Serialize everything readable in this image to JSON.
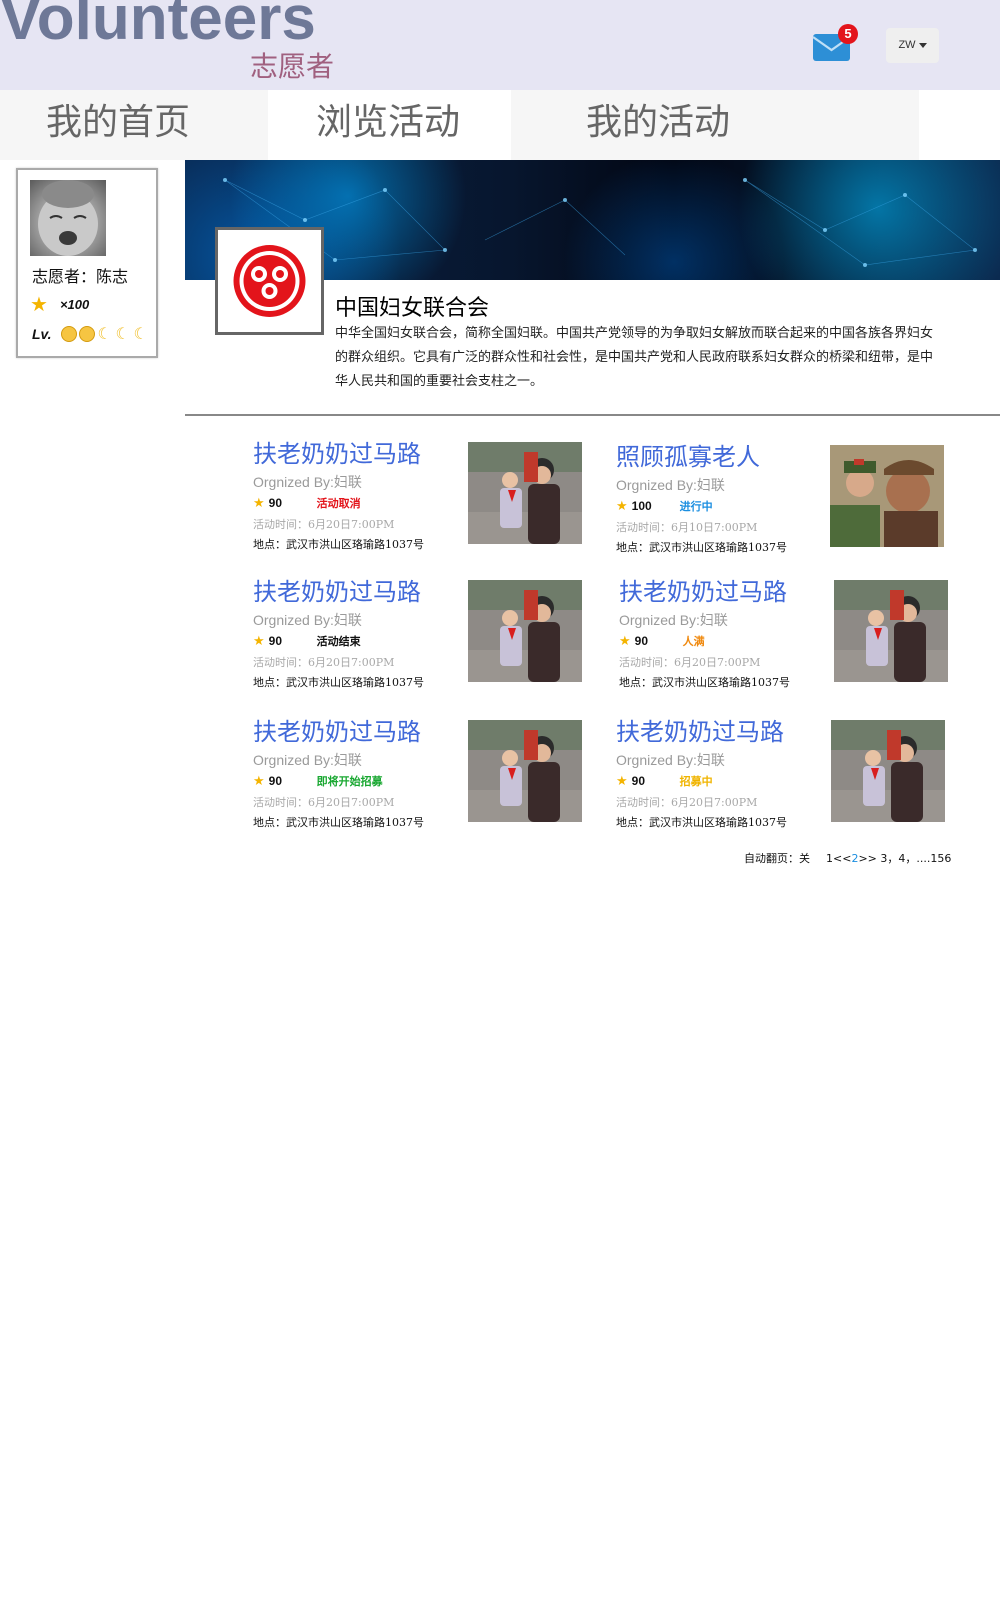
{
  "header": {
    "brand_en": "Volunteers",
    "brand_zh": "志愿者",
    "mail_badge": "5",
    "user_menu": "ZW"
  },
  "nav": {
    "tabs": [
      {
        "label": "我的首页"
      },
      {
        "label": "浏览活动"
      },
      {
        "label": "我的活动"
      }
    ],
    "active_tab": "浏览活动"
  },
  "profile": {
    "name_line": "志愿者：陈志",
    "star_count": "×100",
    "level_label": "Lv."
  },
  "organization": {
    "name": "中国妇女联合会",
    "description": "中华全国妇女联合会，简称全国妇联。中国共产党领导的为争取妇女解放而联合起来的中国各族各界妇女的群众组织。它具有广泛的群众性和社会性，是中国共产党和人民政府联系妇女群众的桥梁和纽带，是中华人民共和国的重要社会支柱之一。"
  },
  "activities": [
    {
      "title": "扶老奶奶过马路",
      "org": "Orgnized By:妇联",
      "points": "90",
      "status": "活动取消",
      "status_color": "#e3141b",
      "time": "活动时间：6月20日7:00PM",
      "location": "地点：武汉市洪山区珞瑜路1037号",
      "photo": "children-crossing-photo"
    },
    {
      "title": "照顾孤寡老人",
      "org": "Orgnized By:妇联",
      "points": "100",
      "status": "进行中",
      "status_color": "#1a8ee0",
      "time": "活动时间：6月10日7:00PM",
      "location": "地点：武汉市洪山区珞瑜路1037号",
      "photo": "elderly-soldier-photo"
    },
    {
      "title": "扶老奶奶过马路",
      "org": "Orgnized By:妇联",
      "points": "90",
      "status": "活动结束",
      "status_color": "#111111",
      "time": "活动时间：6月20日7:00PM",
      "location": "地点：武汉市洪山区珞瑜路1037号",
      "photo": "children-crossing-photo"
    },
    {
      "title": "扶老奶奶过马路",
      "org": "Orgnized By:妇联",
      "points": "90",
      "status": "人满",
      "status_color": "#f08a10",
      "time": "活动时间：6月20日7:00PM",
      "location": "地点：武汉市洪山区珞瑜路1037号",
      "photo": "children-crossing-photo"
    },
    {
      "title": "扶老奶奶过马路",
      "org": "Orgnized By:妇联",
      "points": "90",
      "status": "即将开始招募",
      "status_color": "#1aa832",
      "time": "活动时间：6月20日7:00PM",
      "location": "地点：武汉市洪山区珞瑜路1037号",
      "photo": "children-crossing-photo"
    },
    {
      "title": "扶老奶奶过马路",
      "org": "Orgnized By:妇联",
      "points": "90",
      "status": "招募中",
      "status_color": "#f0b400",
      "time": "活动时间：6月20日7:00PM",
      "location": "地点：武汉市洪山区珞瑜路1037号",
      "photo": "children-crossing-photo"
    }
  ],
  "pager": {
    "auto_label": "自动翻页：关",
    "first": "1<<",
    "current": "2",
    "rest": ">> 3，4，....156"
  },
  "colors": {
    "header_bg": "#e6e5f3",
    "brand_en": "#6e7897",
    "brand_zh": "#a0607f",
    "activity_title": "#4169d9",
    "badge_red": "#e3141b"
  }
}
